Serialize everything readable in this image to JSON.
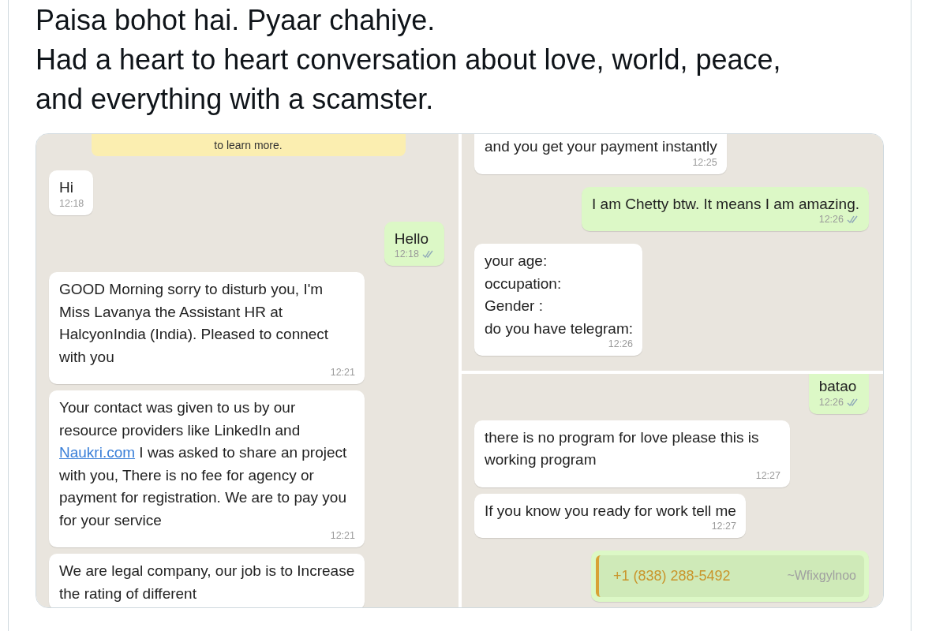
{
  "tweet": {
    "paragraphs": [
      "Paisa bohot hai. Pyaar chahiye.",
      "Had a heart to heart conversation about love, world, peace, and everything with a scamster."
    ]
  },
  "screenshot": {
    "left_panel": {
      "notice": "to learn more.",
      "messages": [
        {
          "kind": "in",
          "text": "Hi",
          "time": "12:18"
        },
        {
          "kind": "out",
          "text": "Hello",
          "time": "12:18"
        },
        {
          "kind": "in",
          "text": "GOOD Morning sorry to disturb you, I'm Miss Lavanya the Assistant HR at HalcyonIndia (India). Pleased to connect with you",
          "time": "12:21"
        },
        {
          "kind": "in",
          "text": "Your contact was given to us by our resource providers like LinkedIn and",
          "link": "Naukri.com",
          "text_after": "I was asked to share an project with you, There is no fee for agency or payment for registration. We are to pay you for your service",
          "time": "12:21"
        },
        {
          "kind": "in",
          "text": "We are legal company, our job is to Increase the rating of different"
        }
      ]
    },
    "right_top": {
      "messages": [
        {
          "kind": "in",
          "text": "and you get your payment instantly",
          "time": "12:25"
        },
        {
          "kind": "out",
          "text": "I am Chetty btw. It means I am amazing.",
          "time": "12:26"
        },
        {
          "kind": "in",
          "text": "your age:\noccupation:\nGender :\ndo you have telegram:",
          "time": "12:26"
        }
      ]
    },
    "right_bottom": {
      "messages": [
        {
          "kind": "out",
          "text": "batao",
          "time": "12:26"
        },
        {
          "kind": "in",
          "text": "there is no program for love please this is working program",
          "time": "12:27"
        },
        {
          "kind": "in",
          "text": "If you know you ready for work tell me",
          "time": "12:27"
        },
        {
          "kind": "quote",
          "quote_number": "+1 (838) 288-5492",
          "quote_name": "~Wfixgylnoo"
        }
      ]
    }
  }
}
